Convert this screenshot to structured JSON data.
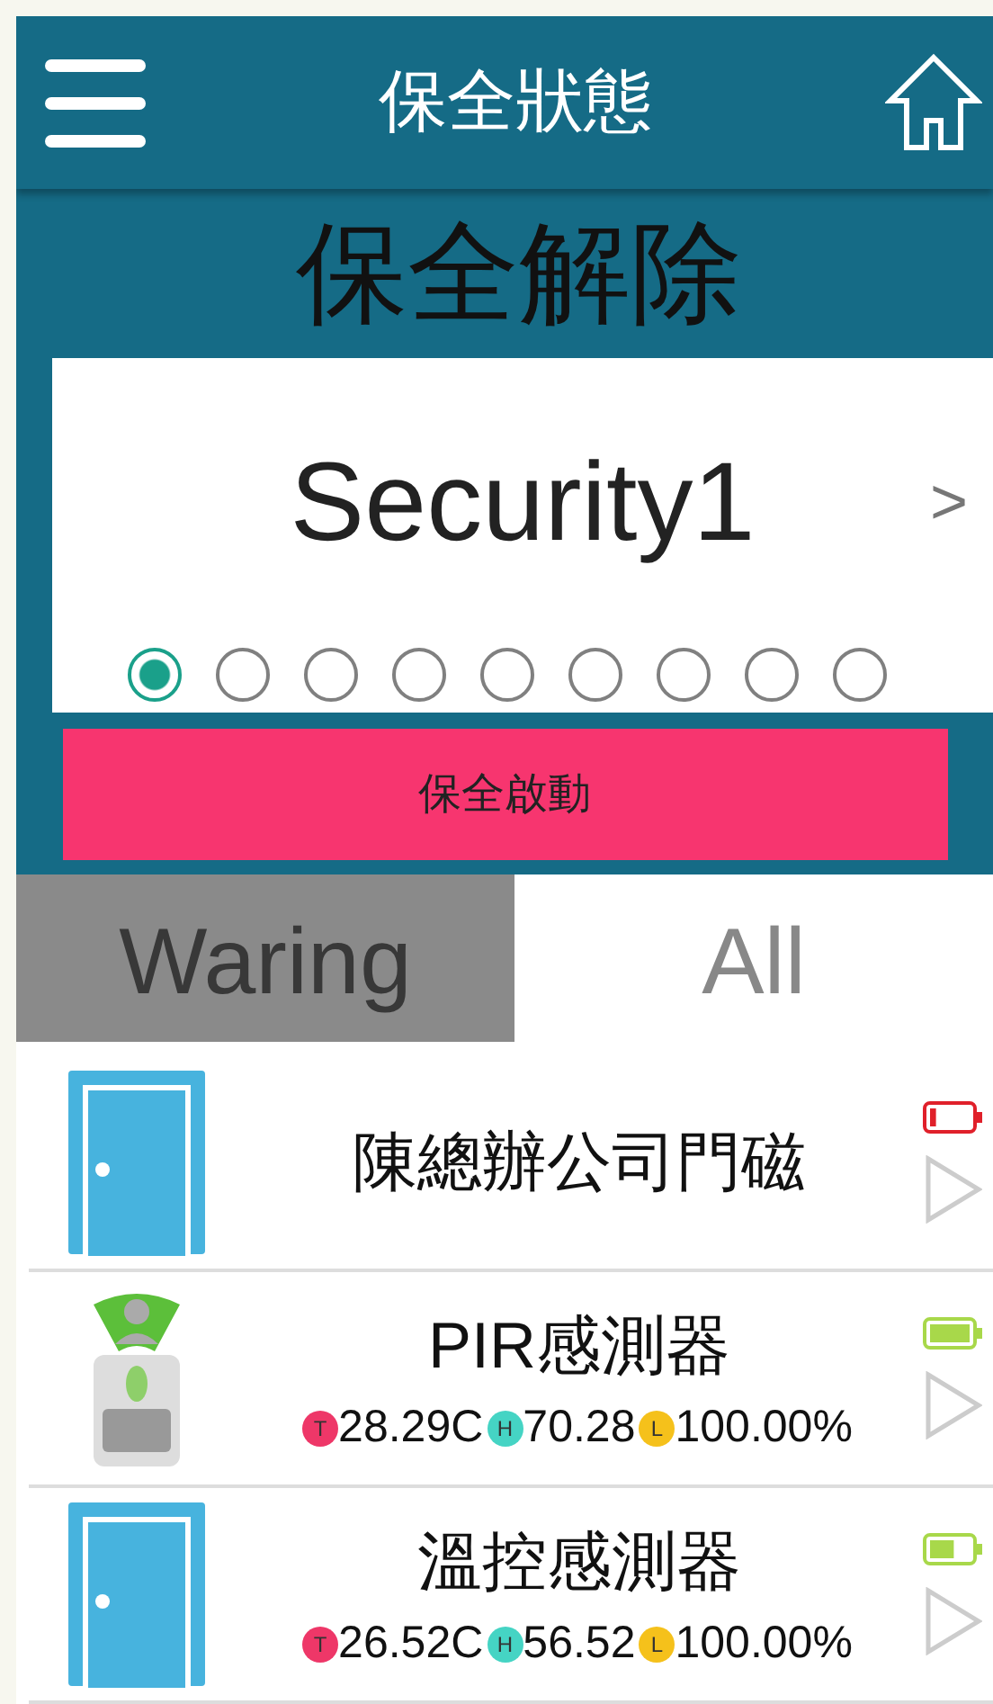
{
  "header": {
    "title": "保全狀態"
  },
  "status": {
    "state": "保全解除",
    "card_title": "Security1",
    "next": ">"
  },
  "pager": [
    {
      "selected": true
    },
    {
      "selected": false
    },
    {
      "selected": false
    },
    {
      "selected": false
    },
    {
      "selected": false
    },
    {
      "selected": false
    },
    {
      "selected": false
    },
    {
      "selected": false
    },
    {
      "selected": false
    }
  ],
  "action_button": "保全啟動",
  "tabs": [
    {
      "label": "Waring",
      "selected": true
    },
    {
      "label": "All",
      "selected": false
    }
  ],
  "devices": [
    {
      "kind": "door",
      "name": "陳總辦公司門磁",
      "battery": {
        "kind": "low"
      }
    },
    {
      "kind": "pir",
      "name": "PIR感測器",
      "battery": {
        "kind": "full"
      },
      "readings": [
        {
          "kind": "T",
          "badge": "T",
          "value": "28.29C"
        },
        {
          "kind": "H",
          "badge": "H",
          "value": "70.28"
        },
        {
          "kind": "L",
          "badge": "L",
          "value": "100.00%"
        }
      ]
    },
    {
      "kind": "door",
      "name": "溫控感測器",
      "battery": {
        "kind": "medium"
      },
      "readings": [
        {
          "kind": "T",
          "badge": "T",
          "value": "26.52C"
        },
        {
          "kind": "H",
          "badge": "H",
          "value": "56.52"
        },
        {
          "kind": "L",
          "badge": "L",
          "value": "100.00%"
        }
      ]
    }
  ]
}
